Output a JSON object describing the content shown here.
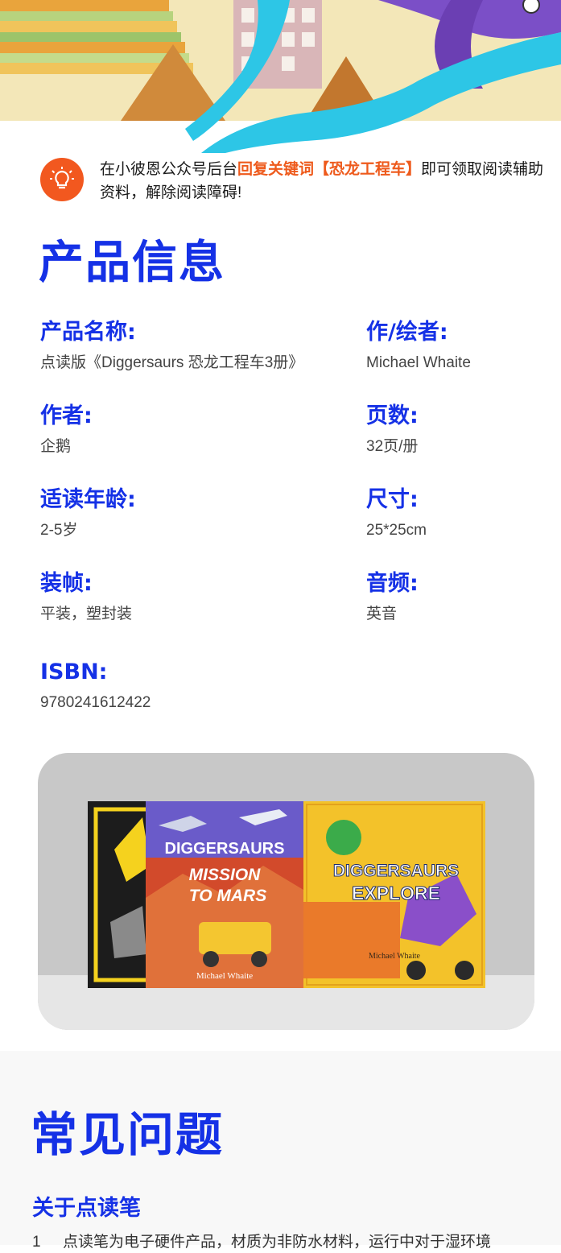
{
  "tip": {
    "icon": "lightbulb-icon",
    "text_before": "在小彼恩公众号后台",
    "highlight": "回复关键词【恐龙工程车】",
    "text_after": "即可领取阅读辅助资料，解除阅读障碍!"
  },
  "product_info": {
    "title": "产品信息",
    "items": [
      {
        "label": "产品名称:",
        "value": "点读版《Diggersaurs 恐龙工程车3册》"
      },
      {
        "label": "作/绘者:",
        "value": "Michael Whaite"
      },
      {
        "label": "作者:",
        "value": "企鹅"
      },
      {
        "label": "页数:",
        "value": "32页/册"
      },
      {
        "label": "适读年龄:",
        "value": "2-5岁"
      },
      {
        "label": "尺寸:",
        "value": "25*25cm"
      },
      {
        "label": "装帧:",
        "value": "平装，塑封装"
      },
      {
        "label": "音频:",
        "value": "英音"
      },
      {
        "label": "ISBN:",
        "value": "9780241612422"
      }
    ]
  },
  "product_image": {
    "books": [
      {
        "title_line1": "DIGGERSAURS",
        "title_line2": "MISSION",
        "title_line3": "TO MARS",
        "author": "Michael Whaite"
      },
      {
        "title_line1": "DIGGERSAURS",
        "title_line2": "EXPLORE",
        "author": "Michael Whaite"
      }
    ]
  },
  "faq": {
    "title": "常见问题",
    "subtitle": "关于点读笔",
    "line_number": "1",
    "line_text": "点读笔为电子硬件产品，材质为非防水材料，运行中对于湿环境"
  },
  "colors": {
    "accent_blue": "#1531e6",
    "accent_orange": "#f2581f"
  }
}
